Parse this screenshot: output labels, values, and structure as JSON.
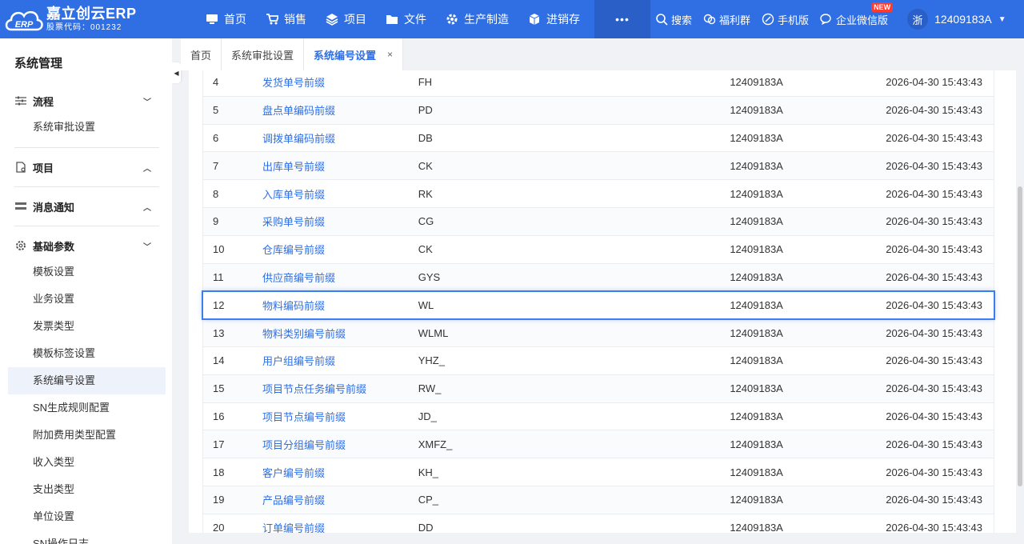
{
  "app": {
    "logo_title": "嘉立创云ERP",
    "logo_sub": "股票代码：001232",
    "logo_mark": "ERP"
  },
  "nav": [
    {
      "label": "首页",
      "icon": "monitor-icon"
    },
    {
      "label": "销售",
      "icon": "cart-icon"
    },
    {
      "label": "项目",
      "icon": "layers-icon"
    },
    {
      "label": "文件",
      "icon": "folder-icon"
    },
    {
      "label": "生产制造",
      "icon": "gear-icon"
    },
    {
      "label": "进销存",
      "icon": "cube-icon"
    }
  ],
  "nav_more": "•••",
  "tools": {
    "search": "搜索",
    "welfare": "福利群",
    "mobile": "手机版",
    "wechat": "企业微信版",
    "new_badge": "NEW"
  },
  "user": {
    "avatar_text": "浙",
    "name": "12409183A"
  },
  "sidebar": {
    "title": "系统管理",
    "groups": [
      {
        "label": "流程",
        "chevron": "⌄",
        "items": [
          "系统审批设置"
        ]
      },
      {
        "label": "项目",
        "chevron": "⌃",
        "items": []
      },
      {
        "label": "消息通知",
        "chevron": "⌃",
        "items": []
      },
      {
        "label": "基础参数",
        "chevron": "⌄",
        "items": [
          "模板设置",
          "业务设置",
          "发票类型",
          "模板标签设置",
          "系统编号设置",
          "SN生成规则配置",
          "附加费用类型配置",
          "收入类型",
          "支出类型",
          "单位设置",
          "SN操作日志"
        ]
      }
    ],
    "active_item": "系统编号设置"
  },
  "tabs": [
    {
      "label": "首页"
    },
    {
      "label": "系统审批设置"
    },
    {
      "label": "系统编号设置",
      "active": true,
      "close": "×"
    }
  ],
  "table": {
    "rows": [
      {
        "no": "4",
        "name": "发货单号前缀",
        "code": "FH",
        "user": "12409183A",
        "time": "2026-04-30 15:43:43"
      },
      {
        "no": "5",
        "name": "盘点单编码前缀",
        "code": "PD",
        "user": "12409183A",
        "time": "2026-04-30 15:43:43"
      },
      {
        "no": "6",
        "name": "调拨单编码前缀",
        "code": "DB",
        "user": "12409183A",
        "time": "2026-04-30 15:43:43"
      },
      {
        "no": "7",
        "name": "出库单号前缀",
        "code": "CK",
        "user": "12409183A",
        "time": "2026-04-30 15:43:43"
      },
      {
        "no": "8",
        "name": "入库单号前缀",
        "code": "RK",
        "user": "12409183A",
        "time": "2026-04-30 15:43:43"
      },
      {
        "no": "9",
        "name": "采购单号前缀",
        "code": "CG",
        "user": "12409183A",
        "time": "2026-04-30 15:43:43"
      },
      {
        "no": "10",
        "name": "仓库编号前缀",
        "code": "CK",
        "user": "12409183A",
        "time": "2026-04-30 15:43:43"
      },
      {
        "no": "11",
        "name": "供应商编号前缀",
        "code": "GYS",
        "user": "12409183A",
        "time": "2026-04-30 15:43:43"
      },
      {
        "no": "12",
        "name": "物料编码前缀",
        "code": "WL",
        "user": "12409183A",
        "time": "2026-04-30 15:43:43",
        "selected": true
      },
      {
        "no": "13",
        "name": "物料类别编号前缀",
        "code": "WLML",
        "user": "12409183A",
        "time": "2026-04-30 15:43:43"
      },
      {
        "no": "14",
        "name": "用户组编号前缀",
        "code": "YHZ_",
        "user": "12409183A",
        "time": "2026-04-30 15:43:43"
      },
      {
        "no": "15",
        "name": "项目节点任务编号前缀",
        "code": "RW_",
        "user": "12409183A",
        "time": "2026-04-30 15:43:43"
      },
      {
        "no": "16",
        "name": "项目节点编号前缀",
        "code": "JD_",
        "user": "12409183A",
        "time": "2026-04-30 15:43:43"
      },
      {
        "no": "17",
        "name": "项目分组编号前缀",
        "code": "XMFZ_",
        "user": "12409183A",
        "time": "2026-04-30 15:43:43"
      },
      {
        "no": "18",
        "name": "客户编号前缀",
        "code": "KH_",
        "user": "12409183A",
        "time": "2026-04-30 15:43:43"
      },
      {
        "no": "19",
        "name": "产品编号前缀",
        "code": "CP_",
        "user": "12409183A",
        "time": "2026-04-30 15:43:43"
      },
      {
        "no": "20",
        "name": "订单编号前缀",
        "code": "DD",
        "user": "12409183A",
        "time": "2026-04-30 15:43:43"
      }
    ]
  },
  "colors": {
    "brand": "#2f6fe3",
    "link": "#2f6fe3",
    "selected_border": "#3b7ef0",
    "new_badge": "#ff3b30"
  }
}
